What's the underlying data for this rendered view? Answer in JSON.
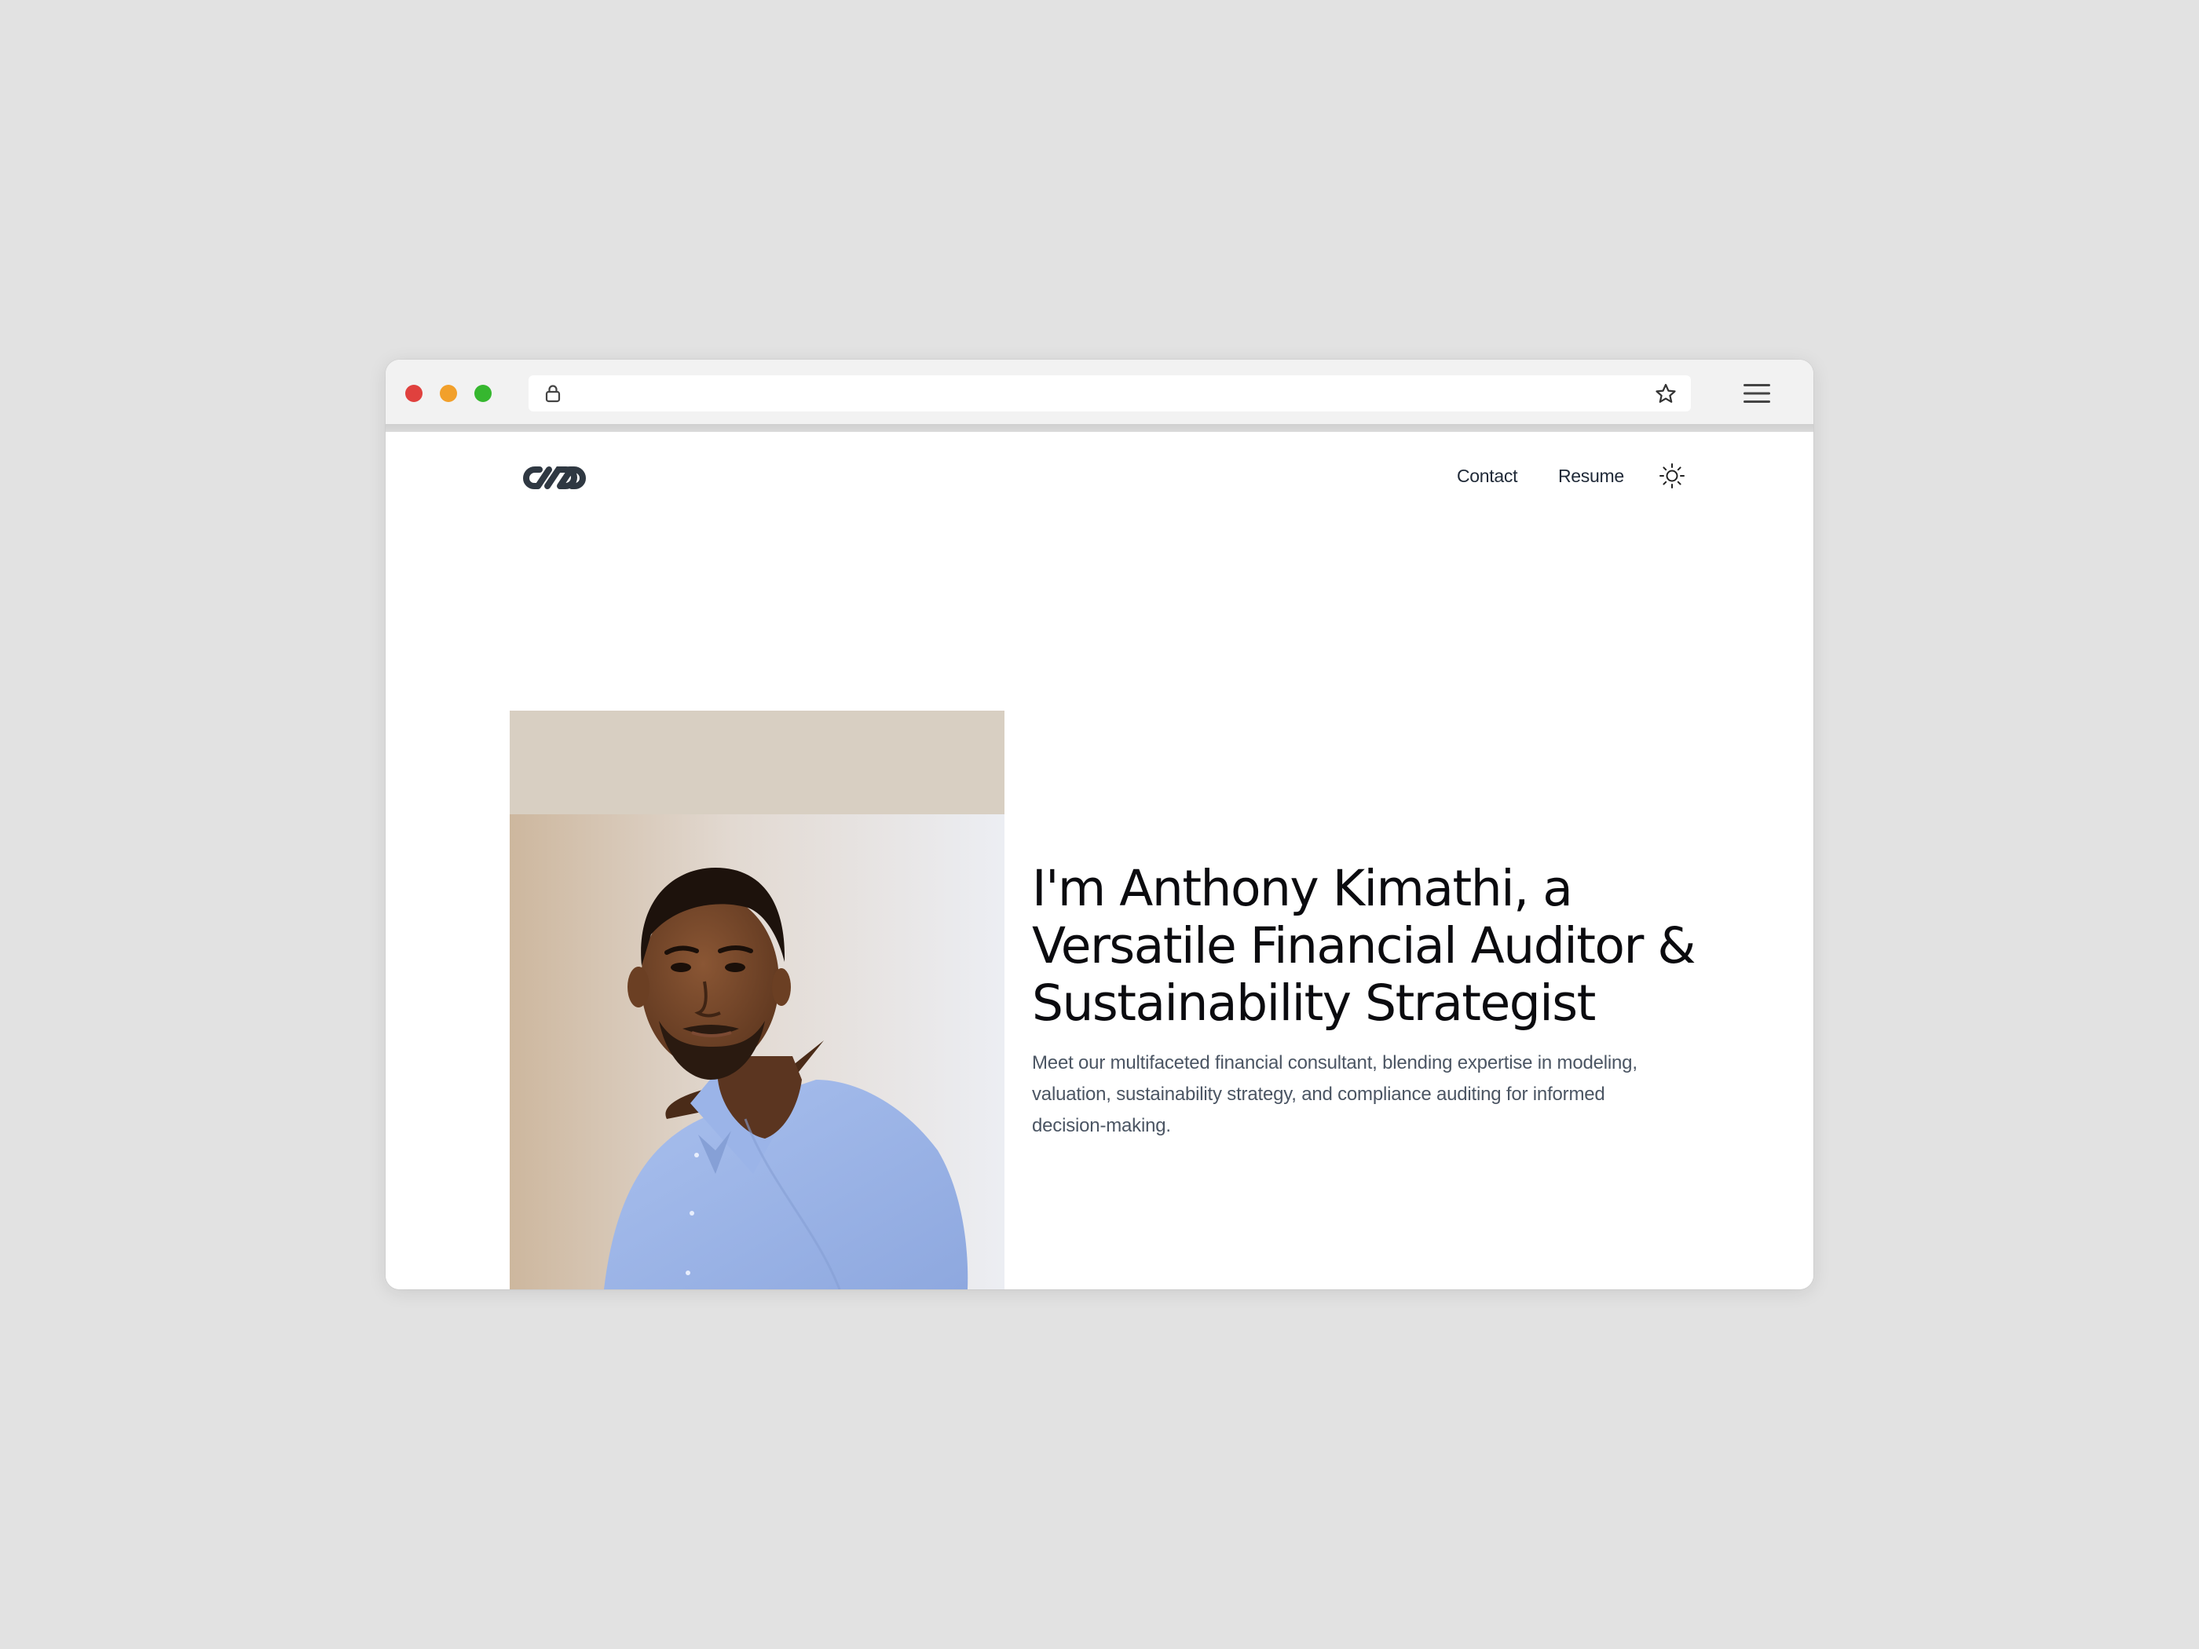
{
  "browser": {
    "traffic_lights": {
      "close_color": "#e0413e",
      "minimize_color": "#f2a02b",
      "maximize_color": "#36b72f"
    },
    "address_bar": {
      "url": "",
      "lock_icon": "lock-icon",
      "bookmark_icon": "star-icon"
    },
    "menu_icon": "hamburger-menu-icon"
  },
  "header": {
    "logo_icon": "chain-link-logo",
    "nav": [
      {
        "label": "Contact"
      },
      {
        "label": "Resume"
      }
    ],
    "theme_toggle_icon": "sun-icon"
  },
  "hero": {
    "photo_icon": "portrait-photo",
    "title": "I'm Anthony Kimathi, a Versatile Financial Auditor & Sustainability Strategist",
    "subtitle": "Meet our multifaceted financial consultant, blending expertise in modeling, valuation, sustainability strategy, and compliance auditing for informed decision-making."
  },
  "colors": {
    "page_background": "#e2e2e2",
    "chrome_background": "#f2f2f2",
    "title_text": "#0b0b0f",
    "body_text": "#4b5563",
    "shirt_blue": "#9fb6e6"
  }
}
